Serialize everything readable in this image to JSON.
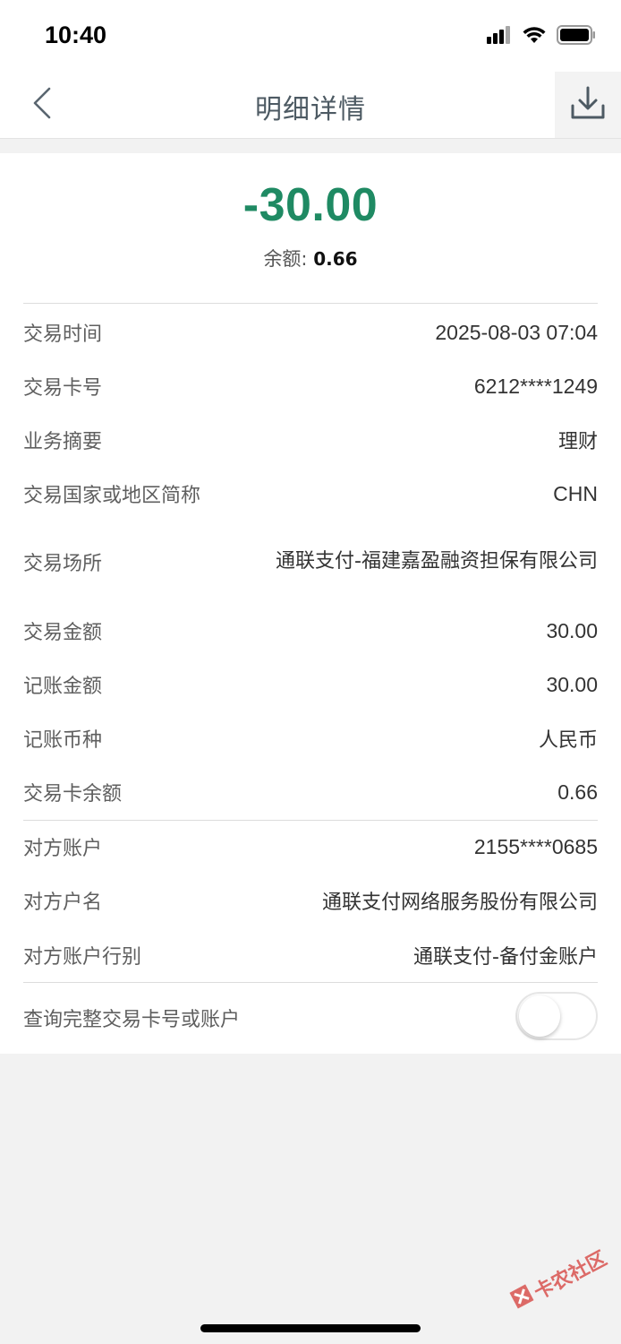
{
  "status_bar": {
    "time": "10:40"
  },
  "nav": {
    "title": "明细详情"
  },
  "summary": {
    "amount": "-30.00",
    "balance_label": "余额:",
    "balance_value": "0.66",
    "amount_color": "#1f8a63"
  },
  "details": [
    {
      "label": "交易时间",
      "value": "2025-08-03 07:04"
    },
    {
      "label": "交易卡号",
      "value": "6212****1249"
    },
    {
      "label": "业务摘要",
      "value": "理财"
    },
    {
      "label": "交易国家或地区简称",
      "value": "CHN"
    },
    {
      "label": "交易场所",
      "value": "通联支付-福建嘉盈融资担保有限公司"
    },
    {
      "label": "交易金额",
      "value": "30.00"
    },
    {
      "label": "记账金额",
      "value": "30.00"
    },
    {
      "label": "记账币种",
      "value": "人民币"
    },
    {
      "label": "交易卡余额",
      "value": "0.66"
    }
  ],
  "counterparty": [
    {
      "label": "对方账户",
      "value": "2155****0685"
    },
    {
      "label": "对方户名",
      "value": "通联支付网络服务股份有限公司"
    },
    {
      "label": "对方账户行别",
      "value": "通联支付-备付金账户"
    }
  ],
  "toggle_row": {
    "label": "查询完整交易卡号或账户",
    "on": false
  },
  "watermark": {
    "text": "卡农社区"
  },
  "icons": {
    "back": "chevron-left-icon",
    "download": "download-icon",
    "signal": "signal-icon",
    "wifi": "wifi-icon",
    "battery": "battery-icon"
  }
}
